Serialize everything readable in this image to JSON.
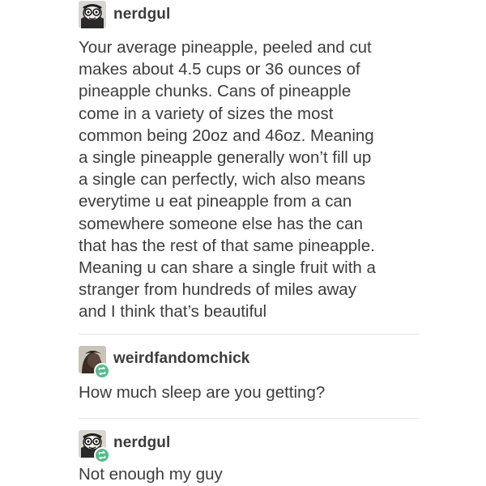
{
  "thread": {
    "post1": {
      "username": "nerdgul",
      "avatar_icon": "cartoon-face-avatar-icon",
      "lines": [
        "Your average pineapple, peeled and cut",
        "makes about 4.5 cups or 36 ounces of",
        "pineapple chunks. Cans of pineapple",
        "come in a variety of sizes the most",
        "common being 20oz and 46oz. Meaning",
        "a single pineapple generally won’t fill up",
        "a single can perfectly, wich also means",
        "everytime u eat pineapple from a can",
        "somewhere someone else has the can",
        "that has the rest of that same pineapple.",
        "Meaning u can share a single fruit with a",
        "stranger from hundreds of miles away",
        "and I think that’s beautiful"
      ]
    },
    "post2": {
      "username": "weirdfandomchick",
      "avatar_icon": "dark-hair-avatar-icon",
      "badge_icon": "reblog-icon",
      "text": "How much sleep are you getting?"
    },
    "post3": {
      "username": "nerdgul",
      "avatar_icon": "cartoon-face-avatar-icon",
      "badge_icon": "reblog-icon",
      "text": "Not enough my guy"
    }
  },
  "colors": {
    "text": "#3d3d3d",
    "divider": "#e4e4e4",
    "reblog_badge": "#56bc8a"
  }
}
